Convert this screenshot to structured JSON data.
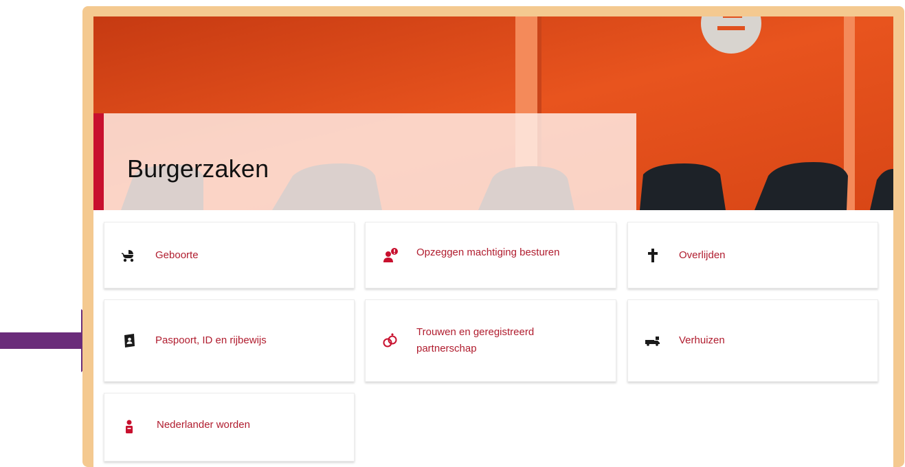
{
  "page": {
    "title": "Burgerzaken"
  },
  "tiles": [
    {
      "label": "Geboorte",
      "icon": "baby-stroller-icon"
    },
    {
      "label": "Opzeggen machtiging besturen",
      "icon": "person-alert-icon"
    },
    {
      "label": "Overlijden",
      "icon": "cross-icon"
    },
    {
      "label": "Paspoort, ID en rijbewijs",
      "icon": "passport-icon"
    },
    {
      "label": "Trouwen en geregistreerd partnerschap",
      "icon": "rings-icon"
    },
    {
      "label": "Verhuizen",
      "icon": "moving-truck-icon"
    },
    {
      "label": "Nederlander worden",
      "icon": "citizen-icon"
    }
  ],
  "colors": {
    "frame": "#f4c990",
    "accent": "#c8102e",
    "link": "#b01c2e",
    "hero": "#e0501e",
    "arrow": "#6a2c7a"
  }
}
